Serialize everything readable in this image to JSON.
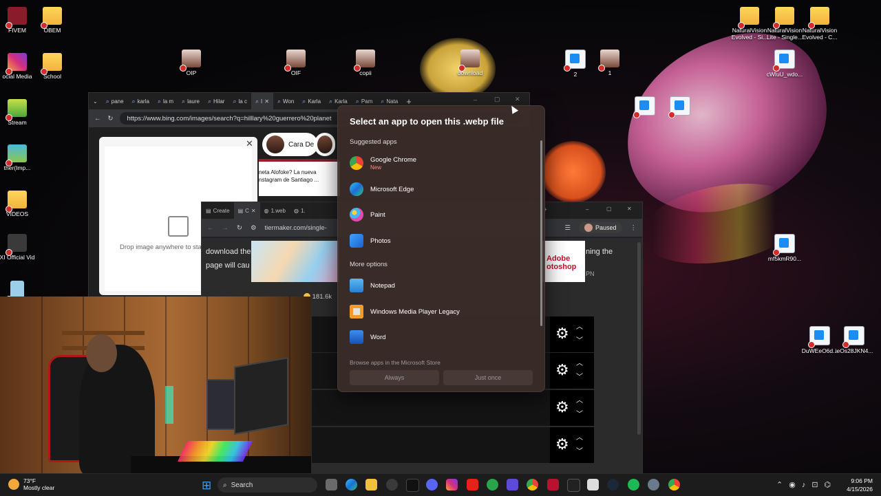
{
  "desktop": {
    "icons": [
      {
        "label": "FIVEM"
      },
      {
        "label": "OBEM"
      },
      {
        "label": "ocial Media"
      },
      {
        "label": "School"
      },
      {
        "label": "Stream"
      },
      {
        "label": "ther(Imp..."
      },
      {
        "label": "VIDEOS"
      },
      {
        "label": "XI Official Vid"
      },
      {
        "label": "OIP"
      },
      {
        "label": "OIF"
      },
      {
        "label": "copii"
      },
      {
        "label": "download"
      },
      {
        "label": "2"
      },
      {
        "label": "1"
      },
      {
        "label": "NaturalVision Evolved - Si..."
      },
      {
        "label": "NaturalVision Lite - Single..."
      },
      {
        "label": "NaturalVision Evolved - C..."
      },
      {
        "label": "cWluU_wdo..."
      },
      {
        "label": "mf5kmR90..."
      },
      {
        "label": "DuWEeO6d..."
      },
      {
        "label": "ieOs28JKN4..."
      }
    ]
  },
  "browser_back": {
    "tabs": [
      "pane",
      "karla",
      "la m",
      "laure",
      "Hilar",
      "la c",
      "I",
      "Won",
      "Karla",
      "Karla",
      "Pam",
      "Nata"
    ],
    "url": "https://www.bing.com/images/search?q=hilllary%20guerrero%20planet",
    "drop_text": "Drop image anywhere to star",
    "chip_label": "Cara De",
    "news_text": "neta Alofoke? La nueva nstagram de Santiago ..."
  },
  "browser_front": {
    "tabs": [
      "Create",
      "C",
      "1.web",
      "1."
    ],
    "url": "tiermaker.com/single-",
    "paused_label": "Paused",
    "para_left_1": "download the",
    "para_left_2": "page will cau",
    "para_right": "ning the",
    "ad_text": "Adobe otoshop",
    "pn": "PN",
    "count": "181.6k"
  },
  "dialog": {
    "title": "Select an app to open this .webp file",
    "suggested_label": "Suggested apps",
    "more_label": "More options",
    "apps": [
      {
        "name": "Google Chrome",
        "sub": "New"
      },
      {
        "name": "Microsoft Edge"
      },
      {
        "name": "Paint"
      },
      {
        "name": "Photos"
      },
      {
        "name": "Notepad"
      },
      {
        "name": "Windows Media Player Legacy"
      },
      {
        "name": "Word"
      }
    ],
    "store_link": "Browse apps in the Microsoft Store",
    "always_label": "Always",
    "once_label": "Just once"
  },
  "taskbar": {
    "weather_temp": "73°F",
    "weather_desc": "Mostly clear",
    "search_label": "Search",
    "time": "9:06 PM",
    "date": "4/15/2026"
  },
  "colors": {
    "dialog_bg": "#3a2d28",
    "accent_red": "#ff8a8a",
    "taskbar": "#1c1c1c"
  }
}
